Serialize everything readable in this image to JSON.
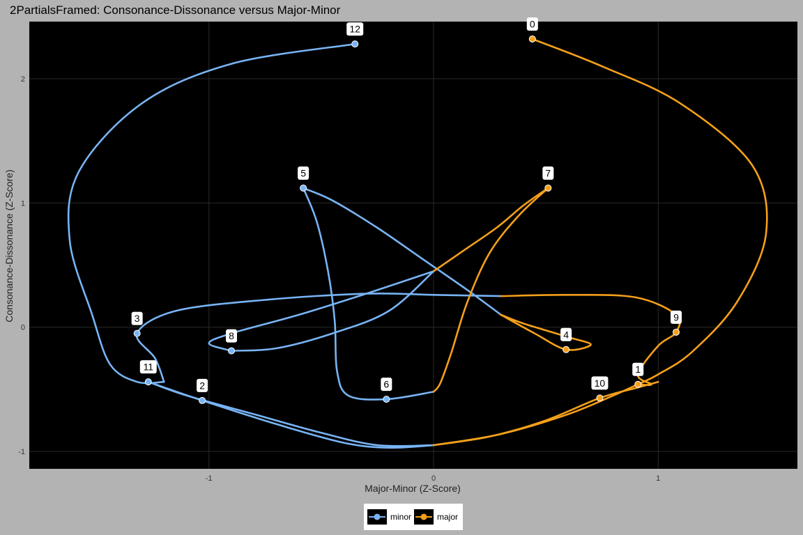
{
  "chart_data": {
    "type": "line",
    "title": "2PartialsFramed: Consonance-Dissonance versus Major-Minor",
    "xlabel": "Major-Minor (Z-Score)",
    "ylabel": "Consonance-Dissonance (Z-Score)",
    "xlim": [
      -1.8,
      1.62
    ],
    "ylim": [
      -1.14,
      2.46
    ],
    "x_ticks": [
      -1,
      0,
      1
    ],
    "y_ticks": [
      -1,
      0,
      1,
      2
    ],
    "x_tick_labels": [
      "-1",
      "0",
      "1"
    ],
    "y_tick_labels": [
      "-1",
      "0",
      "1",
      "2"
    ],
    "grid": true,
    "legend_position": "bottom",
    "series": [
      {
        "name": "minor",
        "color": "#78b4f5",
        "points": [
          {
            "label": "12",
            "x": -0.35,
            "y": 2.28
          },
          {
            "label": "5",
            "x": -0.58,
            "y": 1.12
          },
          {
            "label": "3",
            "x": -1.32,
            "y": -0.05
          },
          {
            "label": "8",
            "x": -0.9,
            "y": -0.19
          },
          {
            "label": "11",
            "x": -1.27,
            "y": -0.44
          },
          {
            "label": "2",
            "x": -1.03,
            "y": -0.59
          },
          {
            "label": "6",
            "x": -0.21,
            "y": -0.58
          }
        ]
      },
      {
        "name": "major",
        "color": "#f5a01a",
        "points": [
          {
            "label": "0",
            "x": 0.44,
            "y": 2.32
          },
          {
            "label": "7",
            "x": 0.51,
            "y": 1.12
          },
          {
            "label": "9",
            "x": 1.08,
            "y": -0.04
          },
          {
            "label": "4",
            "x": 0.59,
            "y": -0.18
          },
          {
            "label": "1",
            "x": 0.91,
            "y": -0.46
          },
          {
            "label": "10",
            "x": 0.74,
            "y": -0.57
          }
        ]
      }
    ],
    "curves": [
      {
        "series": "minor",
        "path": [
          [
            -0.35,
            2.28
          ],
          [
            -0.9,
            2.12
          ],
          [
            -1.3,
            1.8
          ],
          [
            -1.58,
            1.25
          ],
          [
            -1.62,
            0.7
          ],
          [
            -1.52,
            0.1
          ],
          [
            -1.44,
            -0.3
          ],
          [
            -1.32,
            -0.44
          ],
          [
            -1.2,
            -0.44
          ]
        ]
      },
      {
        "series": "minor",
        "path": [
          [
            -1.2,
            -0.44
          ],
          [
            -1.24,
            -0.25
          ],
          [
            -1.32,
            -0.05
          ],
          [
            -1.15,
            0.13
          ],
          [
            -0.75,
            0.22
          ],
          [
            -0.3,
            0.27
          ],
          [
            0.0,
            0.26
          ],
          [
            0.3,
            0.25
          ]
        ]
      },
      {
        "series": "minor",
        "path": [
          [
            -1.27,
            -0.44
          ],
          [
            -1.1,
            -0.55
          ],
          [
            -0.8,
            -0.7
          ],
          [
            -0.5,
            -0.85
          ],
          [
            -0.25,
            -0.95
          ],
          [
            0.0,
            -0.95
          ]
        ]
      },
      {
        "series": "minor",
        "path": [
          [
            -1.27,
            -0.44
          ],
          [
            -1.03,
            -0.59
          ],
          [
            -0.7,
            -0.78
          ],
          [
            -0.4,
            -0.93
          ],
          [
            -0.2,
            -0.97
          ],
          [
            0.0,
            -0.95
          ]
        ]
      },
      {
        "series": "minor",
        "path": [
          [
            -0.58,
            1.12
          ],
          [
            -0.45,
            1.02
          ],
          [
            -0.25,
            0.8
          ],
          [
            -0.05,
            0.55
          ],
          [
            0.15,
            0.3
          ],
          [
            0.3,
            0.1
          ]
        ]
      },
      {
        "series": "minor",
        "path": [
          [
            -0.58,
            1.12
          ],
          [
            -0.52,
            0.85
          ],
          [
            -0.47,
            0.45
          ],
          [
            -0.44,
            0.05
          ],
          [
            -0.43,
            -0.35
          ],
          [
            -0.38,
            -0.55
          ],
          [
            -0.21,
            -0.58
          ],
          [
            0.0,
            -0.52
          ]
        ]
      },
      {
        "series": "minor",
        "path": [
          [
            -0.9,
            -0.19
          ],
          [
            -1.0,
            -0.13
          ],
          [
            -0.9,
            -0.05
          ],
          [
            -0.6,
            0.1
          ],
          [
            -0.3,
            0.27
          ],
          [
            0.0,
            0.45
          ]
        ]
      },
      {
        "series": "minor",
        "path": [
          [
            -0.9,
            -0.19
          ],
          [
            -0.7,
            -0.17
          ],
          [
            -0.45,
            -0.05
          ],
          [
            -0.2,
            0.13
          ],
          [
            0.0,
            0.45
          ]
        ]
      },
      {
        "series": "major",
        "path": [
          [
            0.44,
            2.32
          ],
          [
            0.75,
            2.1
          ],
          [
            1.1,
            1.8
          ],
          [
            1.42,
            1.3
          ],
          [
            1.48,
            0.75
          ],
          [
            1.35,
            0.2
          ],
          [
            1.15,
            -0.2
          ],
          [
            1.0,
            -0.38
          ],
          [
            0.91,
            -0.46
          ]
        ]
      },
      {
        "series": "major",
        "path": [
          [
            0.51,
            1.12
          ],
          [
            0.38,
            0.9
          ],
          [
            0.25,
            0.6
          ],
          [
            0.15,
            0.2
          ],
          [
            0.08,
            -0.2
          ],
          [
            0.03,
            -0.45
          ],
          [
            0.0,
            -0.52
          ]
        ]
      },
      {
        "series": "major",
        "path": [
          [
            0.51,
            1.12
          ],
          [
            0.4,
            0.98
          ],
          [
            0.28,
            0.8
          ],
          [
            0.12,
            0.6
          ],
          [
            0.0,
            0.45
          ]
        ]
      },
      {
        "series": "major",
        "path": [
          [
            0.3,
            0.1
          ],
          [
            0.45,
            -0.05
          ],
          [
            0.59,
            -0.18
          ],
          [
            0.7,
            -0.14
          ],
          [
            0.6,
            -0.08
          ],
          [
            0.4,
            0.03
          ],
          [
            0.3,
            0.1
          ]
        ]
      },
      {
        "series": "major",
        "path": [
          [
            0.3,
            0.25
          ],
          [
            0.6,
            0.26
          ],
          [
            0.9,
            0.24
          ],
          [
            1.08,
            0.1
          ],
          [
            1.08,
            -0.04
          ],
          [
            1.0,
            -0.15
          ],
          [
            0.91,
            -0.38
          ],
          [
            0.97,
            -0.46
          ],
          [
            0.91,
            -0.46
          ]
        ]
      },
      {
        "series": "major",
        "path": [
          [
            0.0,
            -0.95
          ],
          [
            0.25,
            -0.88
          ],
          [
            0.5,
            -0.75
          ],
          [
            0.74,
            -0.57
          ],
          [
            0.9,
            -0.49
          ],
          [
            1.0,
            -0.44
          ]
        ]
      },
      {
        "series": "major",
        "path": [
          [
            0.0,
            -0.95
          ],
          [
            0.3,
            -0.86
          ],
          [
            0.6,
            -0.7
          ],
          [
            0.8,
            -0.55
          ],
          [
            0.91,
            -0.46
          ]
        ]
      }
    ]
  }
}
